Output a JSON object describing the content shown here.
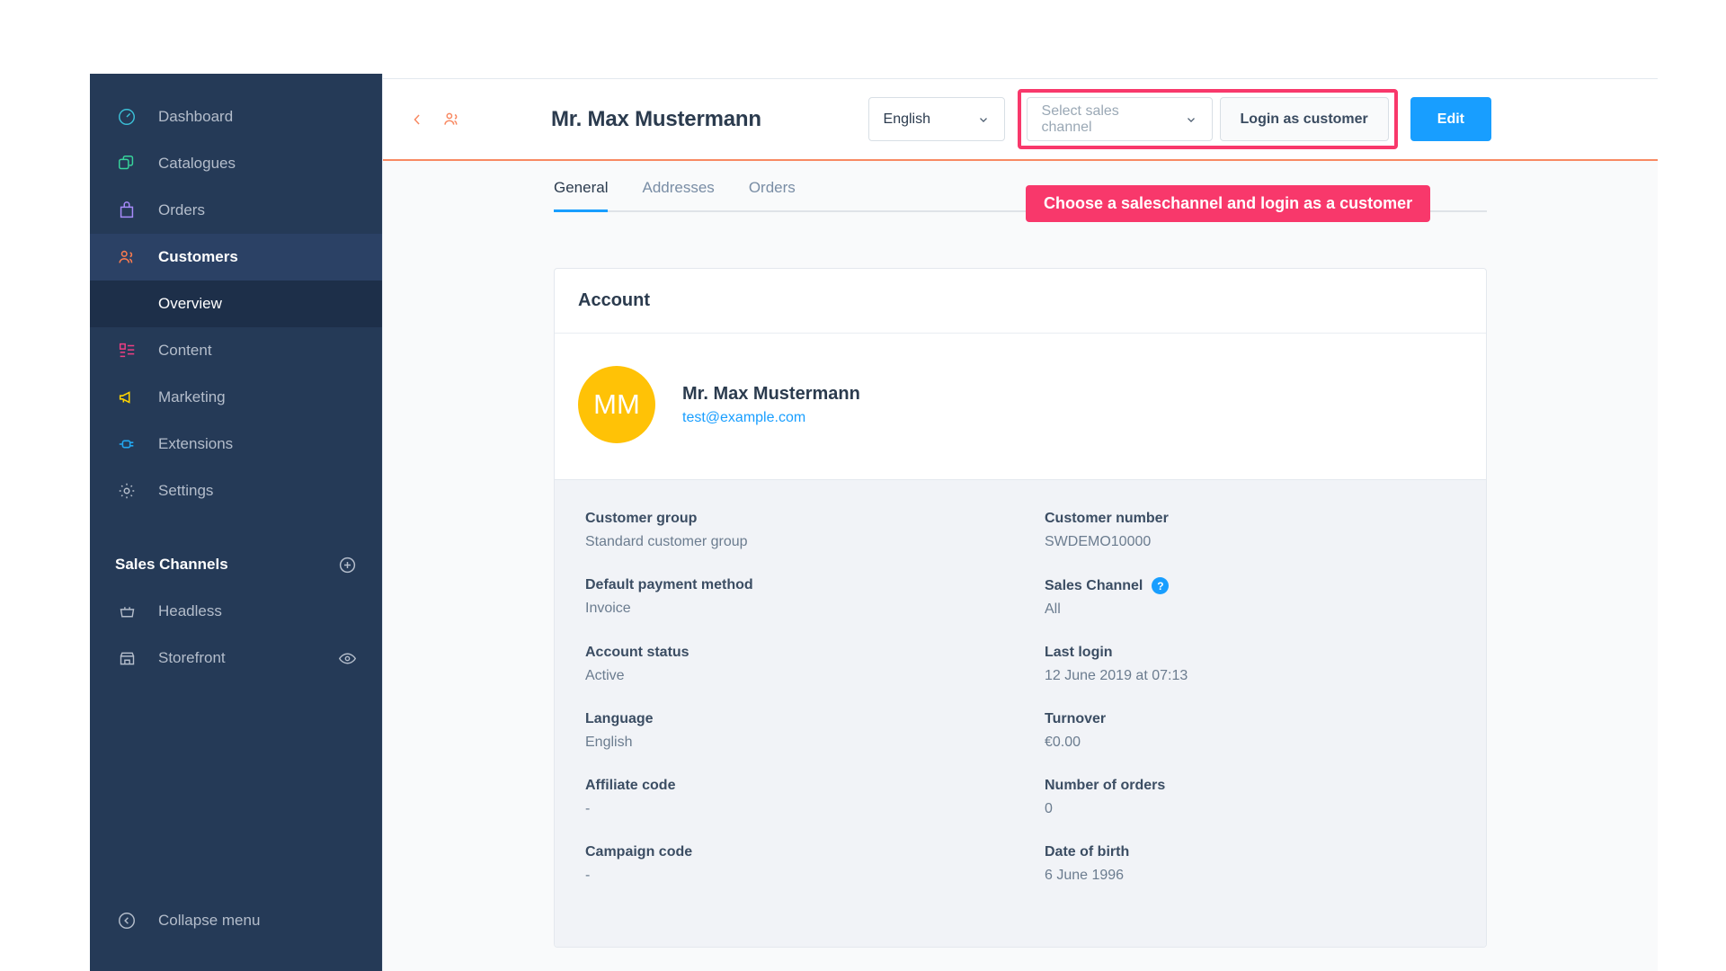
{
  "sidebar": {
    "items": [
      {
        "label": "Dashboard",
        "icon": "speedometer-icon",
        "active": false
      },
      {
        "label": "Catalogues",
        "icon": "copy-icon",
        "active": false
      },
      {
        "label": "Orders",
        "icon": "bag-icon",
        "active": false
      },
      {
        "label": "Customers",
        "icon": "users-icon",
        "active": true
      }
    ],
    "sub_item": {
      "label": "Overview"
    },
    "items_after": [
      {
        "label": "Content",
        "icon": "content-icon"
      },
      {
        "label": "Marketing",
        "icon": "megaphone-icon"
      },
      {
        "label": "Extensions",
        "icon": "plug-icon"
      },
      {
        "label": "Settings",
        "icon": "gear-icon"
      }
    ],
    "sales_channels_title": "Sales Channels",
    "add_channel_icon": "plus-circle-icon",
    "channels": [
      {
        "label": "Headless",
        "icon": "basket-icon",
        "has_eye": false
      },
      {
        "label": "Storefront",
        "icon": "storefront-icon",
        "has_eye": true
      }
    ],
    "collapse": {
      "label": "Collapse menu",
      "icon": "chevron-left-circle-icon"
    }
  },
  "header": {
    "back_icon": "chevron-left-icon",
    "customer_icon": "users-icon",
    "title": "Mr. Max Mustermann",
    "language_select": {
      "value": "English",
      "chevron": "chevron-down-icon"
    },
    "sales_channel_select": {
      "placeholder": "Select sales channel",
      "value": "Select sales channel",
      "chevron": "chevron-down-icon"
    },
    "login_button": "Login as customer",
    "edit_button": "Edit",
    "highlight_color": "#f8386b",
    "accent_color": "#f88962"
  },
  "tooltip": {
    "text": "Choose a saleschannel and login as a customer",
    "color": "#f8386b"
  },
  "tabs": [
    {
      "label": "General",
      "active": true
    },
    {
      "label": "Addresses",
      "active": false
    },
    {
      "label": "Orders",
      "active": false
    }
  ],
  "account_card": {
    "title": "Account",
    "avatar_initials": "MM",
    "avatar_color": "#ffc206",
    "name": "Mr. Max Mustermann",
    "email": "test@example.com",
    "fields_left": [
      {
        "label": "Customer group",
        "value": "Standard customer group"
      },
      {
        "label": "Default payment method",
        "value": "Invoice"
      },
      {
        "label": "Account status",
        "value": "Active"
      },
      {
        "label": "Language",
        "value": "English"
      },
      {
        "label": "Affiliate code",
        "value": "-"
      },
      {
        "label": "Campaign code",
        "value": "-"
      }
    ],
    "fields_right": [
      {
        "label": "Customer number",
        "value": "SWDEMO10000",
        "help": false
      },
      {
        "label": "Sales Channel",
        "value": "All",
        "help": true,
        "help_glyph": "?"
      },
      {
        "label": "Last login",
        "value": "12 June 2019 at 07:13",
        "help": false
      },
      {
        "label": "Turnover",
        "value": "€0.00",
        "help": false
      },
      {
        "label": "Number of orders",
        "value": "0",
        "help": false
      },
      {
        "label": "Date of birth",
        "value": "6 June 1996",
        "help": false
      }
    ]
  }
}
